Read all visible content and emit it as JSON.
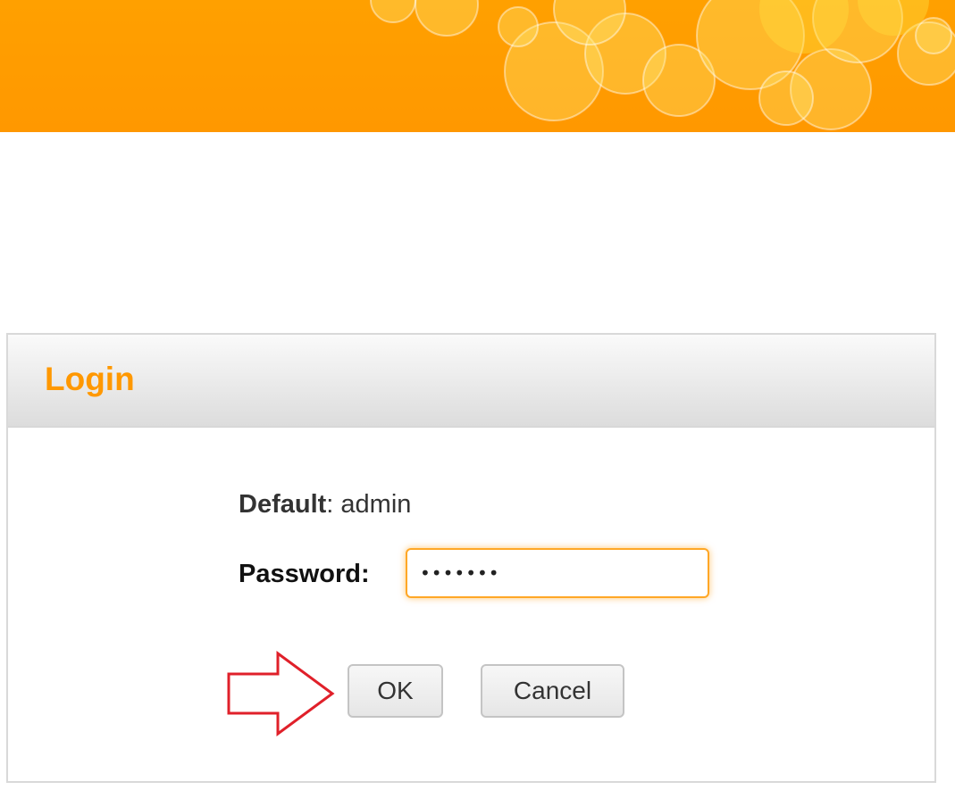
{
  "header": {
    "brand_color": "#ff9800"
  },
  "login": {
    "title": "Login",
    "default_label": "Default",
    "default_value": ": admin",
    "password_label": "Password:",
    "password_value": "•••••••",
    "ok_label": "OK",
    "cancel_label": "Cancel"
  },
  "colors": {
    "accent": "#ff9800",
    "arrow": "#e0202a"
  }
}
